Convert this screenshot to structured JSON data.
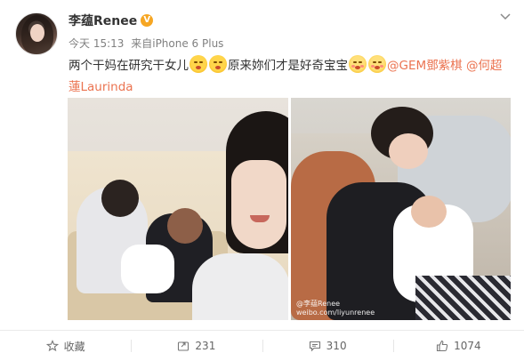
{
  "post": {
    "username": "李蕴Renee",
    "verified_badge": "V",
    "time": "今天 15:13",
    "source": "来自iPhone 6 Plus",
    "text_segments": {
      "part1": "两个干妈在研究干女儿",
      "part2": "原来妳们才是好奇宝宝",
      "mention1": "@GEM鄧紫棋",
      "mention2": "@何超蓮Laurinda"
    },
    "watermark": "@李蕴Renee weibo.com/liyunrenee"
  },
  "actions": {
    "favorite_label": "收藏",
    "repost_count": "231",
    "comment_count": "310",
    "like_count": "1074"
  },
  "icons": {
    "menu": "chevron-down-icon",
    "favorite": "star-icon",
    "repost": "repost-icon",
    "comment": "comment-icon",
    "like": "thumbs-up-icon"
  },
  "colors": {
    "mention": "#eb7350",
    "verified": "#f6a623",
    "meta_text": "#808080"
  }
}
